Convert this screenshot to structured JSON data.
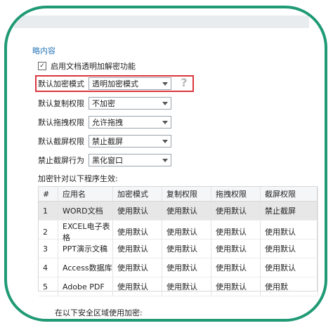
{
  "section": {
    "title": "略内容"
  },
  "enable": {
    "label": "启用文档透明加解密功能"
  },
  "settings": [
    {
      "label": "默认加密模式",
      "value": "透明加密模式"
    },
    {
      "label": "默认复制权限",
      "value": "不加密"
    },
    {
      "label": "默认拖拽权限",
      "value": "允许拖拽"
    },
    {
      "label": "默认截屏权限",
      "value": "禁止截屏"
    },
    {
      "label": "禁止截屏行为",
      "value": "黑化窗口"
    }
  ],
  "programs": {
    "caption": "加密针对以下程序生效:"
  },
  "table": {
    "headers": [
      "#",
      "应用名",
      "加密模式",
      "复制权限",
      "拖拽权限",
      "截屏权限"
    ],
    "rows": [
      [
        "1",
        "WORD文档",
        "使用默认",
        "使用默认",
        "使用默认",
        "禁止截屏"
      ],
      [
        "2",
        "EXCEL电子表格",
        "使用默认",
        "使用默认",
        "使用默认",
        "使用默认"
      ],
      [
        "3",
        "PPT演示文稿",
        "使用默认",
        "使用默认",
        "使用默认",
        "使用默认"
      ],
      [
        "4",
        "Access数据库",
        "使用默认",
        "使用默认",
        "使用默认",
        "使用默认"
      ],
      [
        "5",
        "Adobe PDF",
        "使用默认",
        "使用默认",
        "使用默认",
        "使用默"
      ]
    ]
  },
  "footer": {
    "text": "在以下安全区域使用加密:"
  },
  "icons": {
    "help": "question-icon",
    "dropdown": "chevron-down-icon",
    "check": "check-icon"
  },
  "colors": {
    "frame": "#1f9a74",
    "highlight": "#d9363e",
    "title": "#2b78b8"
  }
}
